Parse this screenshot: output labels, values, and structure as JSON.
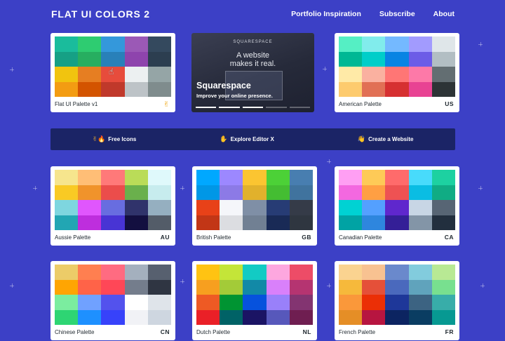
{
  "header": {
    "logo": "FLAT UI COLORS 2",
    "nav": [
      "Portfolio Inspiration",
      "Subscribe",
      "About"
    ]
  },
  "ad": {
    "brand": "SQUARESPACE",
    "slogan_line1": "A website",
    "slogan_line2": "makes it real.",
    "title": "Squarespace",
    "subtitle": "Improve your online presence."
  },
  "banner": [
    {
      "icon": "✌🔥",
      "label": "Free Icons"
    },
    {
      "icon": "✋",
      "label": "Explore Editor X"
    },
    {
      "icon": "👋",
      "label": "Create a Website"
    }
  ],
  "palettes": [
    {
      "name": "Flat UI Palette v1",
      "code": "",
      "icon": "hand-icon",
      "colors": [
        "#1abc9c",
        "#2ecc71",
        "#3498db",
        "#9b59b6",
        "#34495e",
        "#16a085",
        "#27ae60",
        "#2980b9",
        "#8e44ad",
        "#2c3e50",
        "#f1c40f",
        "#e67e22",
        "#e74c3c",
        "#ecf0f1",
        "#95a5a6",
        "#f39c12",
        "#d35400",
        "#c0392b",
        "#bdc3c7",
        "#7f8c8d"
      ]
    },
    {
      "name": "American Palette",
      "code": "US",
      "colors": [
        "#55efc4",
        "#81ecec",
        "#74b9ff",
        "#a29bfe",
        "#dfe6e9",
        "#00b894",
        "#00cec9",
        "#0984e3",
        "#6c5ce7",
        "#b2bec3",
        "#ffeaa7",
        "#fab1a0",
        "#ff7675",
        "#fd79a8",
        "#636e72",
        "#fdcb6e",
        "#e17055",
        "#d63031",
        "#e84393",
        "#2d3436"
      ]
    },
    {
      "name": "Aussie Palette",
      "code": "AU",
      "colors": [
        "#f6e58d",
        "#ffbe76",
        "#ff7979",
        "#badc58",
        "#dff9fb",
        "#f9ca24",
        "#f0932b",
        "#eb4d4b",
        "#6ab04c",
        "#c7ecee",
        "#7ed6df",
        "#e056fd",
        "#686de0",
        "#30336b",
        "#95afc0",
        "#22a6b3",
        "#be2edd",
        "#4834d4",
        "#130f40",
        "#535c68"
      ]
    },
    {
      "name": "British Palette",
      "code": "GB",
      "colors": [
        "#00a8ff",
        "#9c88ff",
        "#fbc531",
        "#4cd137",
        "#487eb0",
        "#0097e6",
        "#8c7ae6",
        "#e1b12c",
        "#44bd32",
        "#40739e",
        "#e84118",
        "#f5f6fa",
        "#7f8fa6",
        "#273c75",
        "#353b48",
        "#c23616",
        "#dcdde1",
        "#718093",
        "#192a56",
        "#2f3640"
      ]
    },
    {
      "name": "Canadian Palette",
      "code": "CA",
      "colors": [
        "#ff9ff3",
        "#feca57",
        "#ff6b6b",
        "#48dbfb",
        "#1dd1a1",
        "#f368e0",
        "#ff9f43",
        "#ee5253",
        "#0abde3",
        "#10ac84",
        "#00d2d3",
        "#54a0ff",
        "#5f27cd",
        "#c8d6e5",
        "#576574",
        "#01a3a4",
        "#2e86de",
        "#341f97",
        "#8395a7",
        "#222f3e"
      ]
    },
    {
      "name": "Chinese Palette",
      "code": "CN",
      "colors": [
        "#eccc68",
        "#ff7f50",
        "#ff6b81",
        "#a4b0be",
        "#57606f",
        "#ffa502",
        "#ff6348",
        "#ff4757",
        "#747d8c",
        "#2f3542",
        "#7bed9f",
        "#70a1ff",
        "#5352ed",
        "#ffffff",
        "#dfe4ea",
        "#2ed573",
        "#1e90ff",
        "#3742fa",
        "#f1f2f6",
        "#ced6e0"
      ]
    },
    {
      "name": "Dutch Palette",
      "code": "NL",
      "colors": [
        "#ffc312",
        "#c4e538",
        "#12cbc4",
        "#fda7df",
        "#ed4c67",
        "#f79f1f",
        "#a3cb38",
        "#1289a7",
        "#d980fa",
        "#b53471",
        "#ee5a24",
        "#009432",
        "#0652dd",
        "#9980fa",
        "#833471",
        "#ea2027",
        "#006266",
        "#1b1464",
        "#5758bb",
        "#6f1e51"
      ]
    },
    {
      "name": "French Palette",
      "code": "FR",
      "colors": [
        "#fad390",
        "#f8c291",
        "#6a89cc",
        "#82ccdd",
        "#b8e994",
        "#f6b93b",
        "#e55039",
        "#4a69bd",
        "#60a3bc",
        "#78e08f",
        "#fa983a",
        "#eb2f06",
        "#1e3799",
        "#3c6382",
        "#38ada9",
        "#e58e26",
        "#b71540",
        "#0c2461",
        "#0a3d62",
        "#079992"
      ]
    }
  ]
}
